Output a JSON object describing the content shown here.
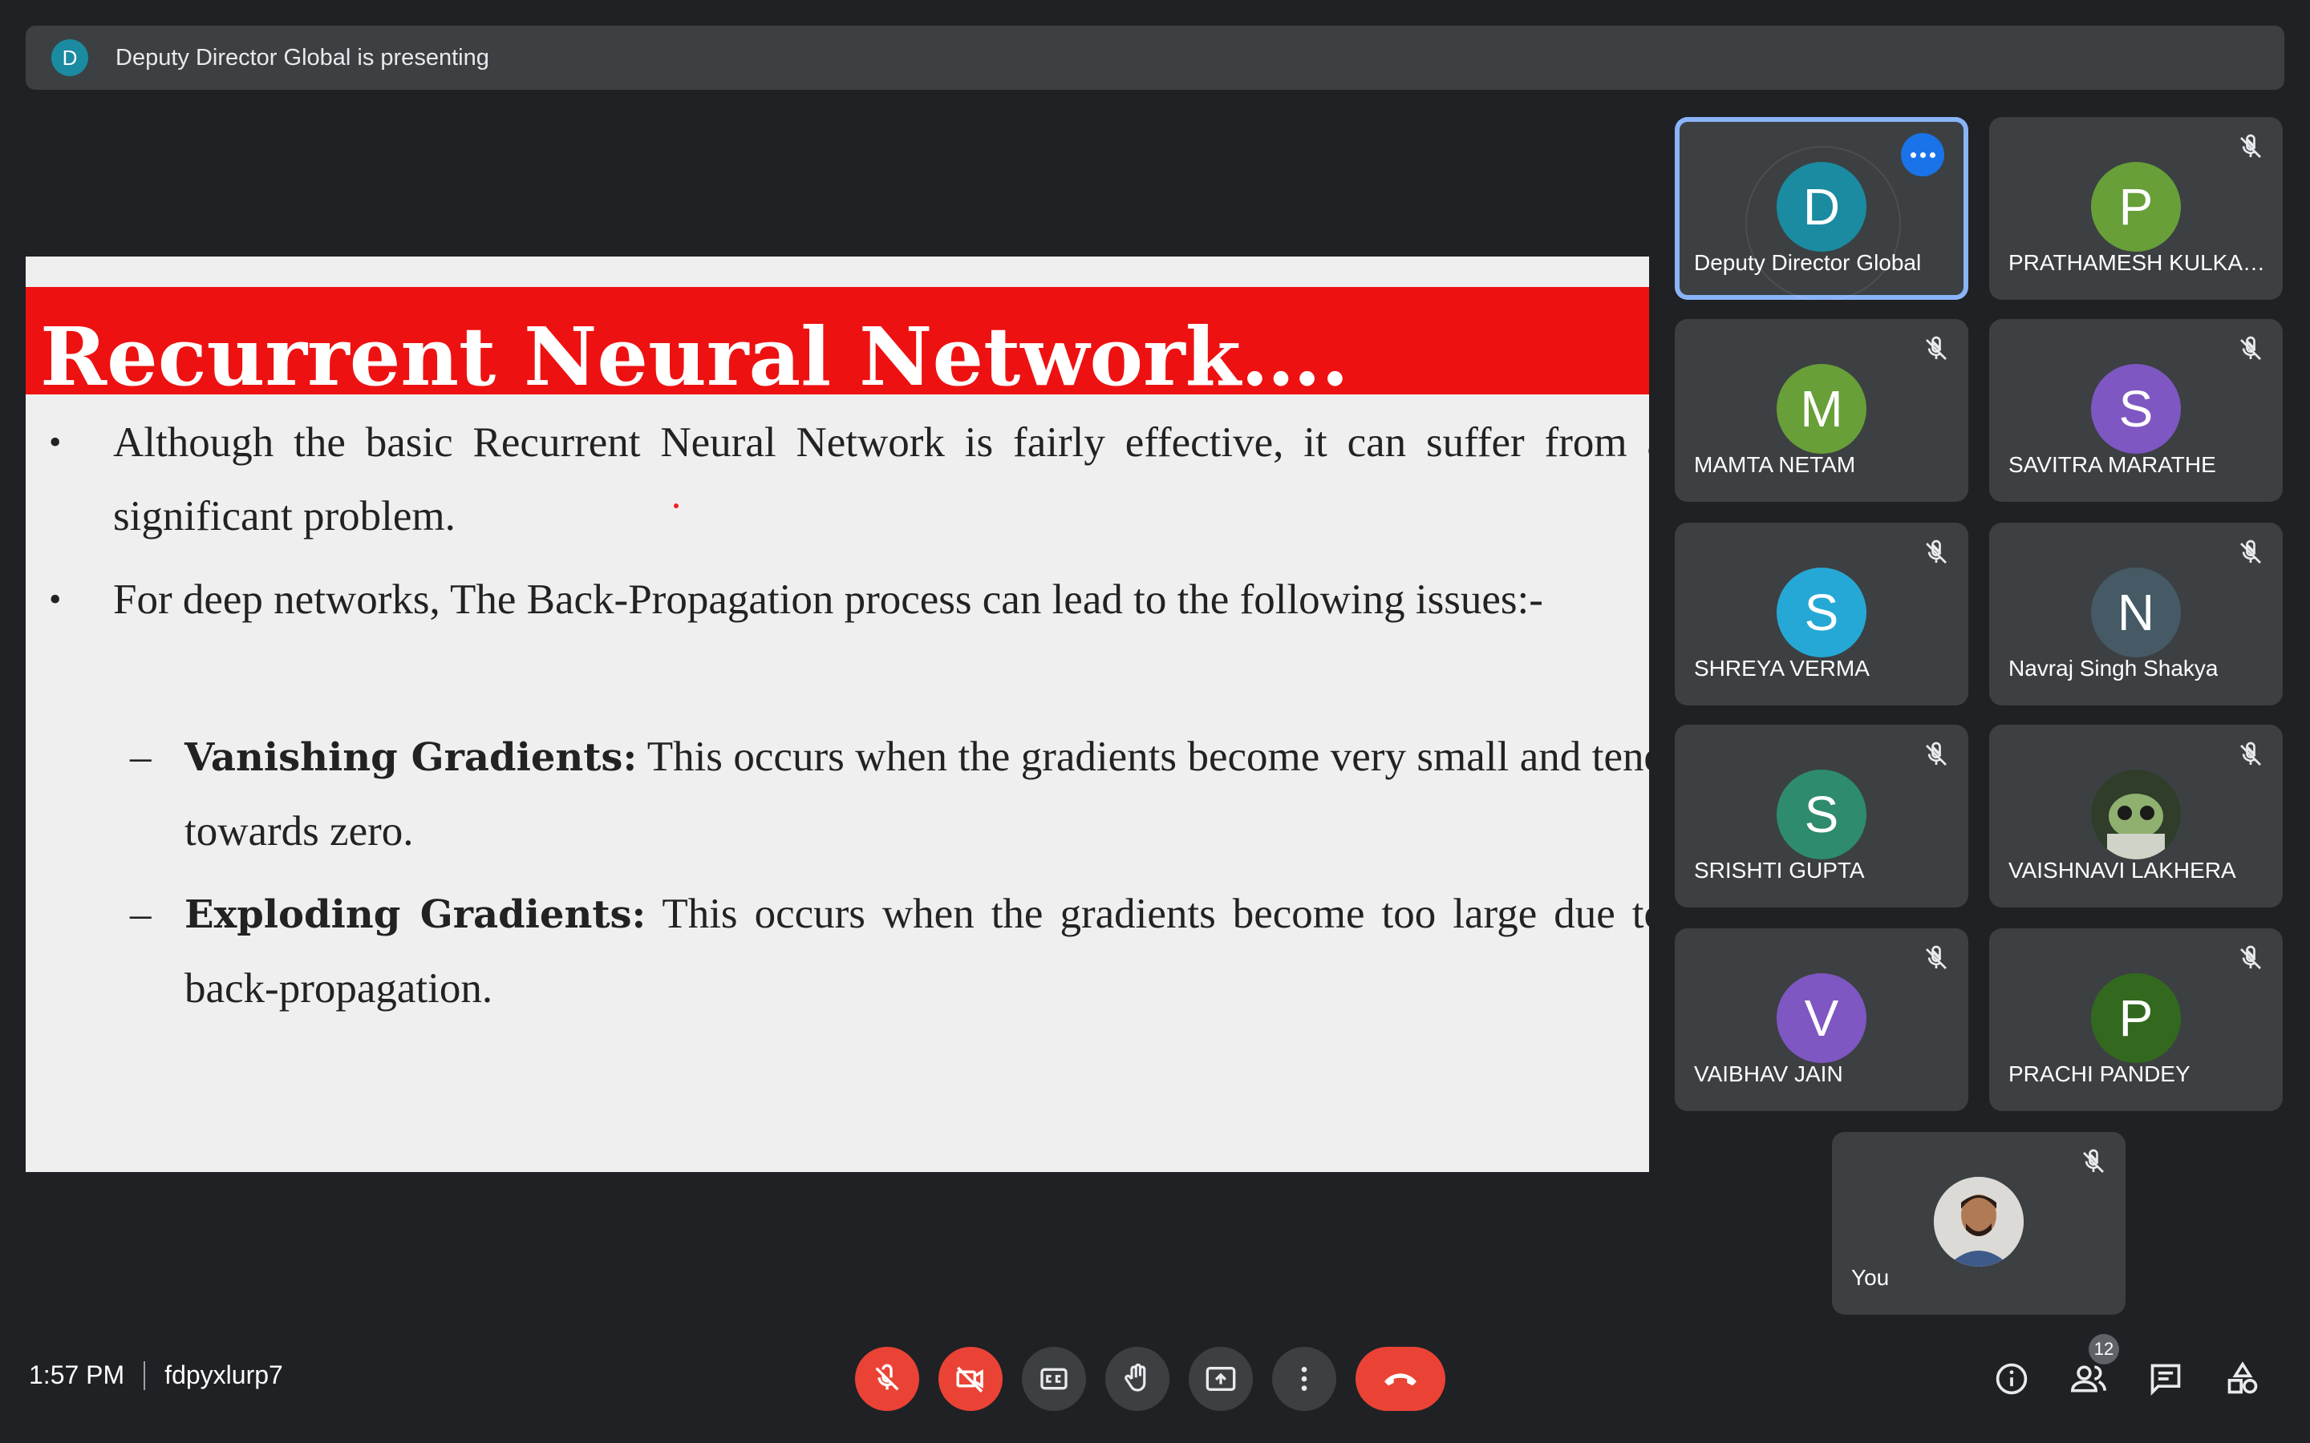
{
  "banner": {
    "avatar_letter": "D",
    "text": "Deputy Director Global is presenting"
  },
  "slide": {
    "title": "Recurrent Neural Network….",
    "bullets": [
      {
        "text": "Although the basic Recurrent Neural Network is fairly effective, it can suffer from a significant problem."
      },
      {
        "text": "For deep networks, The Back-Propagation process can lead to the following issues:-"
      }
    ],
    "sub_bullets": [
      {
        "term": "Vanishing Gradients:",
        "text": " This occurs when the gradients become very small and tend towards zero."
      },
      {
        "term": "Exploding Gradients:",
        "text": " This occurs when the gradients become too large due to back-propagation."
      }
    ],
    "bullet_symbol": "•",
    "dash_symbol": "–"
  },
  "participants": [
    {
      "letter": "D",
      "name": "Deputy Director Global",
      "color": "#1a8ba0",
      "active": true
    },
    {
      "letter": "P",
      "name": "PRATHAMESH KULKAR...",
      "color": "#689f38"
    },
    {
      "letter": "M",
      "name": "MAMTA NETAM",
      "color": "#689f38"
    },
    {
      "letter": "S",
      "name": "SAVITRA MARATHE",
      "color": "#7e57c2"
    },
    {
      "letter": "S",
      "name": "SHREYA VERMA",
      "color": "#26a8d6"
    },
    {
      "letter": "N",
      "name": "Navraj Singh Shakya",
      "color": "#455a64"
    },
    {
      "letter": "S",
      "name": "SRISHTI GUPTA",
      "color": "#2e8b6e"
    },
    {
      "letter": "",
      "name": "VAISHNAVI LAKHERA",
      "color": "#3b5a3a"
    },
    {
      "letter": "V",
      "name": "VAIBHAV JAIN",
      "color": "#7e57c2"
    },
    {
      "letter": "P",
      "name": "PRACHI PANDEY",
      "color": "#33691e"
    }
  ],
  "self_tile": {
    "name": "You"
  },
  "meeting": {
    "time": "1:57 PM",
    "code": "fdpyxlurp7"
  },
  "people_count": "12",
  "colors": {
    "background": "#202124",
    "tile": "#3c4043",
    "accent": "#8ab4f8",
    "danger": "#ea4335"
  },
  "icons": [
    "mic-off-icon",
    "camera-off-icon",
    "captions-icon",
    "raise-hand-icon",
    "present-icon",
    "more-options-icon",
    "end-call-icon",
    "info-icon",
    "people-icon",
    "chat-icon",
    "activities-icon"
  ]
}
